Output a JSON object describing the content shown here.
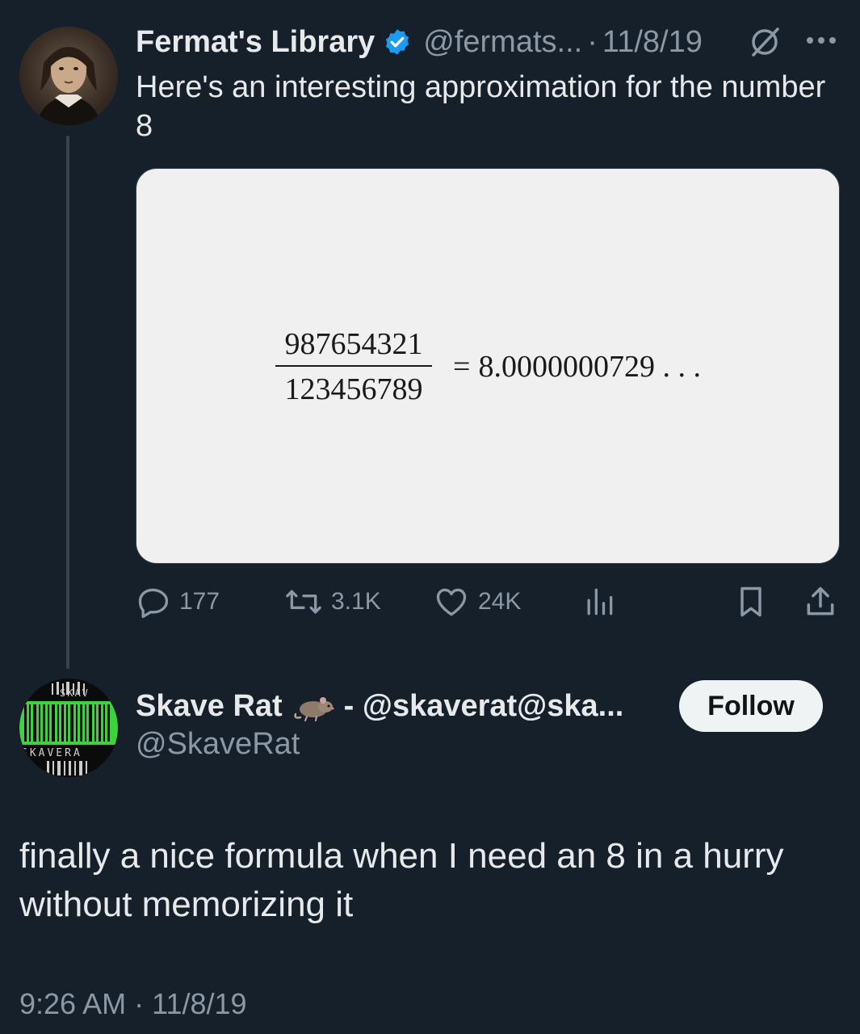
{
  "original_tweet": {
    "display_name": "Fermat's Library",
    "handle": "@fermats...",
    "separator": "·",
    "date": "11/8/19",
    "text": "Here's an interesting approximation for the number 8",
    "media": {
      "numerator": "987654321",
      "denominator": "123456789",
      "equals": "=",
      "result": "8.0000000729 . . ."
    },
    "actions": {
      "replies": "177",
      "retweets": "3.1K",
      "likes": "24K"
    },
    "icons": {
      "verified": "verified-badge-icon",
      "grok": "grok-icon",
      "more": "more-icon",
      "reply": "reply-icon",
      "retweet": "retweet-icon",
      "like": "heart-icon",
      "views": "views-icon",
      "bookmark": "bookmark-icon",
      "share": "share-icon"
    }
  },
  "reply_tweet": {
    "display_name": "Skave Rat",
    "display_name_suffix": "- @skaverat@ska...",
    "handle": "@SkaveRat",
    "follow_label": "Follow",
    "text": "finally a nice formula when I need an 8 in a hurry without memorizing it",
    "time": "9:26 AM",
    "separator": "·",
    "date": "11/8/19",
    "avatar_text_top": "SKAV",
    "avatar_text_bottom": "SKAVERA"
  },
  "colors": {
    "background": "#15202b",
    "primary_text": "#e7e9ea",
    "secondary_text": "#8b98a5",
    "verified_blue": "#1d9bf0",
    "follow_button_bg": "#eff3f4",
    "media_bg": "#f0f0f0",
    "avatar_bar_green": "#3fd23f"
  }
}
